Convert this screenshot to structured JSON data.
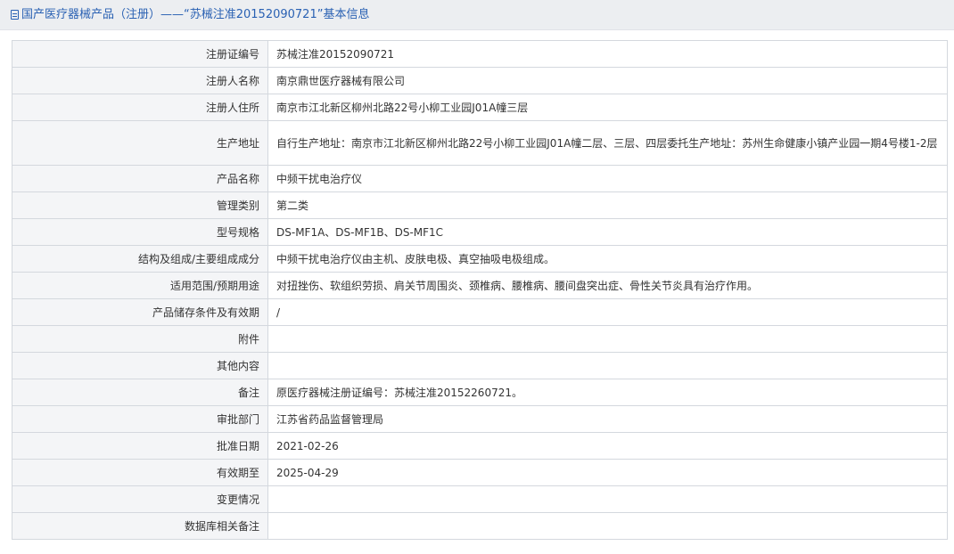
{
  "header": {
    "title": "国产医疗器械产品（注册）——“苏械注准20152090721”基本信息"
  },
  "rows": [
    {
      "label": "注册证编号",
      "value": "苏械注准20152090721"
    },
    {
      "label": "注册人名称",
      "value": "南京鼎世医疗器械有限公司"
    },
    {
      "label": "注册人住所",
      "value": "南京市江北新区柳州北路22号小柳工业园J01A幢三层"
    },
    {
      "label": "生产地址",
      "value": "自行生产地址：南京市江北新区柳州北路22号小柳工业园J01A幢二层、三层、四层委托生产地址：苏州生命健康小镇产业园一期4号楼1-2层"
    },
    {
      "label": "产品名称",
      "value": "中频干扰电治疗仪"
    },
    {
      "label": "管理类别",
      "value": "第二类"
    },
    {
      "label": "型号规格",
      "value": "DS-MF1A、DS-MF1B、DS-MF1C"
    },
    {
      "label": "结构及组成/主要组成成分",
      "value": "中频干扰电治疗仪由主机、皮肤电极、真空抽吸电极组成。"
    },
    {
      "label": "适用范围/预期用途",
      "value": "对扭挫伤、软组织劳损、肩关节周围炎、颈椎病、腰椎病、腰间盘突出症、骨性关节炎具有治疗作用。"
    },
    {
      "label": "产品储存条件及有效期",
      "value": "/"
    },
    {
      "label": "附件",
      "value": ""
    },
    {
      "label": "其他内容",
      "value": ""
    },
    {
      "label": "备注",
      "value": "原医疗器械注册证编号：苏械注准20152260721。"
    },
    {
      "label": "审批部门",
      "value": "江苏省药品监督管理局"
    },
    {
      "label": "批准日期",
      "value": "2021-02-26"
    },
    {
      "label": "有效期至",
      "value": "2025-04-29"
    },
    {
      "label": "变更情况",
      "value": ""
    },
    {
      "label": "数据库相关备注",
      "value": ""
    }
  ]
}
